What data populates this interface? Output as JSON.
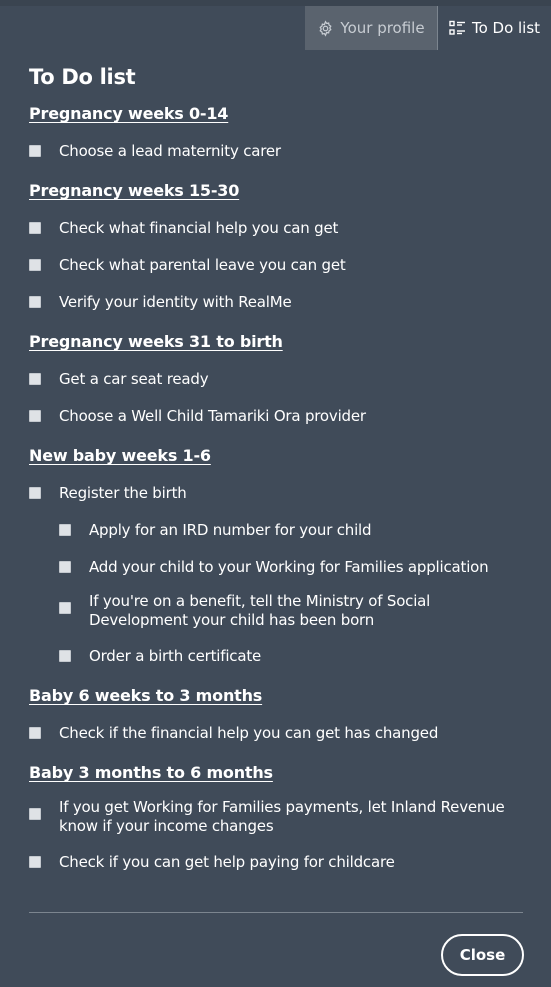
{
  "header": {
    "tabs": [
      {
        "label": "Your profile",
        "icon": "gear-icon",
        "active": false
      },
      {
        "label": "To Do list",
        "icon": "checklist-icon",
        "active": true
      }
    ]
  },
  "page_title": "To Do list",
  "sections": [
    {
      "heading": "Pregnancy weeks 0-14",
      "tasks": [
        {
          "label": "Choose a lead maternity carer",
          "checked": false
        }
      ]
    },
    {
      "heading": "Pregnancy weeks 15-30",
      "tasks": [
        {
          "label": "Check what financial help you can get",
          "checked": false
        },
        {
          "label": "Check what parental leave you can get",
          "checked": false
        },
        {
          "label": "Verify your identity with RealMe",
          "checked": false
        }
      ]
    },
    {
      "heading": "Pregnancy weeks 31 to birth",
      "tasks": [
        {
          "label": "Get a car seat ready",
          "checked": false
        },
        {
          "label": "Choose a Well Child Tamariki Ora provider",
          "checked": false
        }
      ]
    },
    {
      "heading": "New baby weeks 1-6",
      "tasks": [
        {
          "label": "Register the birth",
          "checked": false,
          "subtasks": [
            {
              "label": "Apply for an IRD number for your child",
              "checked": false
            },
            {
              "label": "Add your child to your Working for Families application",
              "checked": false
            },
            {
              "label": "If you're on a benefit, tell the Ministry of Social Development your child has been born",
              "checked": false
            },
            {
              "label": "Order a birth certificate",
              "checked": false
            }
          ]
        }
      ]
    },
    {
      "heading": "Baby 6 weeks to 3 months",
      "tasks": [
        {
          "label": "Check if the financial help you can get has changed",
          "checked": false
        }
      ]
    },
    {
      "heading": "Baby 3 months to 6 months",
      "tasks": [
        {
          "label": "If you get Working for Families payments, let Inland Revenue know if your income changes",
          "checked": false
        },
        {
          "label": "Check if you can get help paying for childcare",
          "checked": false
        }
      ]
    }
  ],
  "footer": {
    "close_label": "Close"
  }
}
